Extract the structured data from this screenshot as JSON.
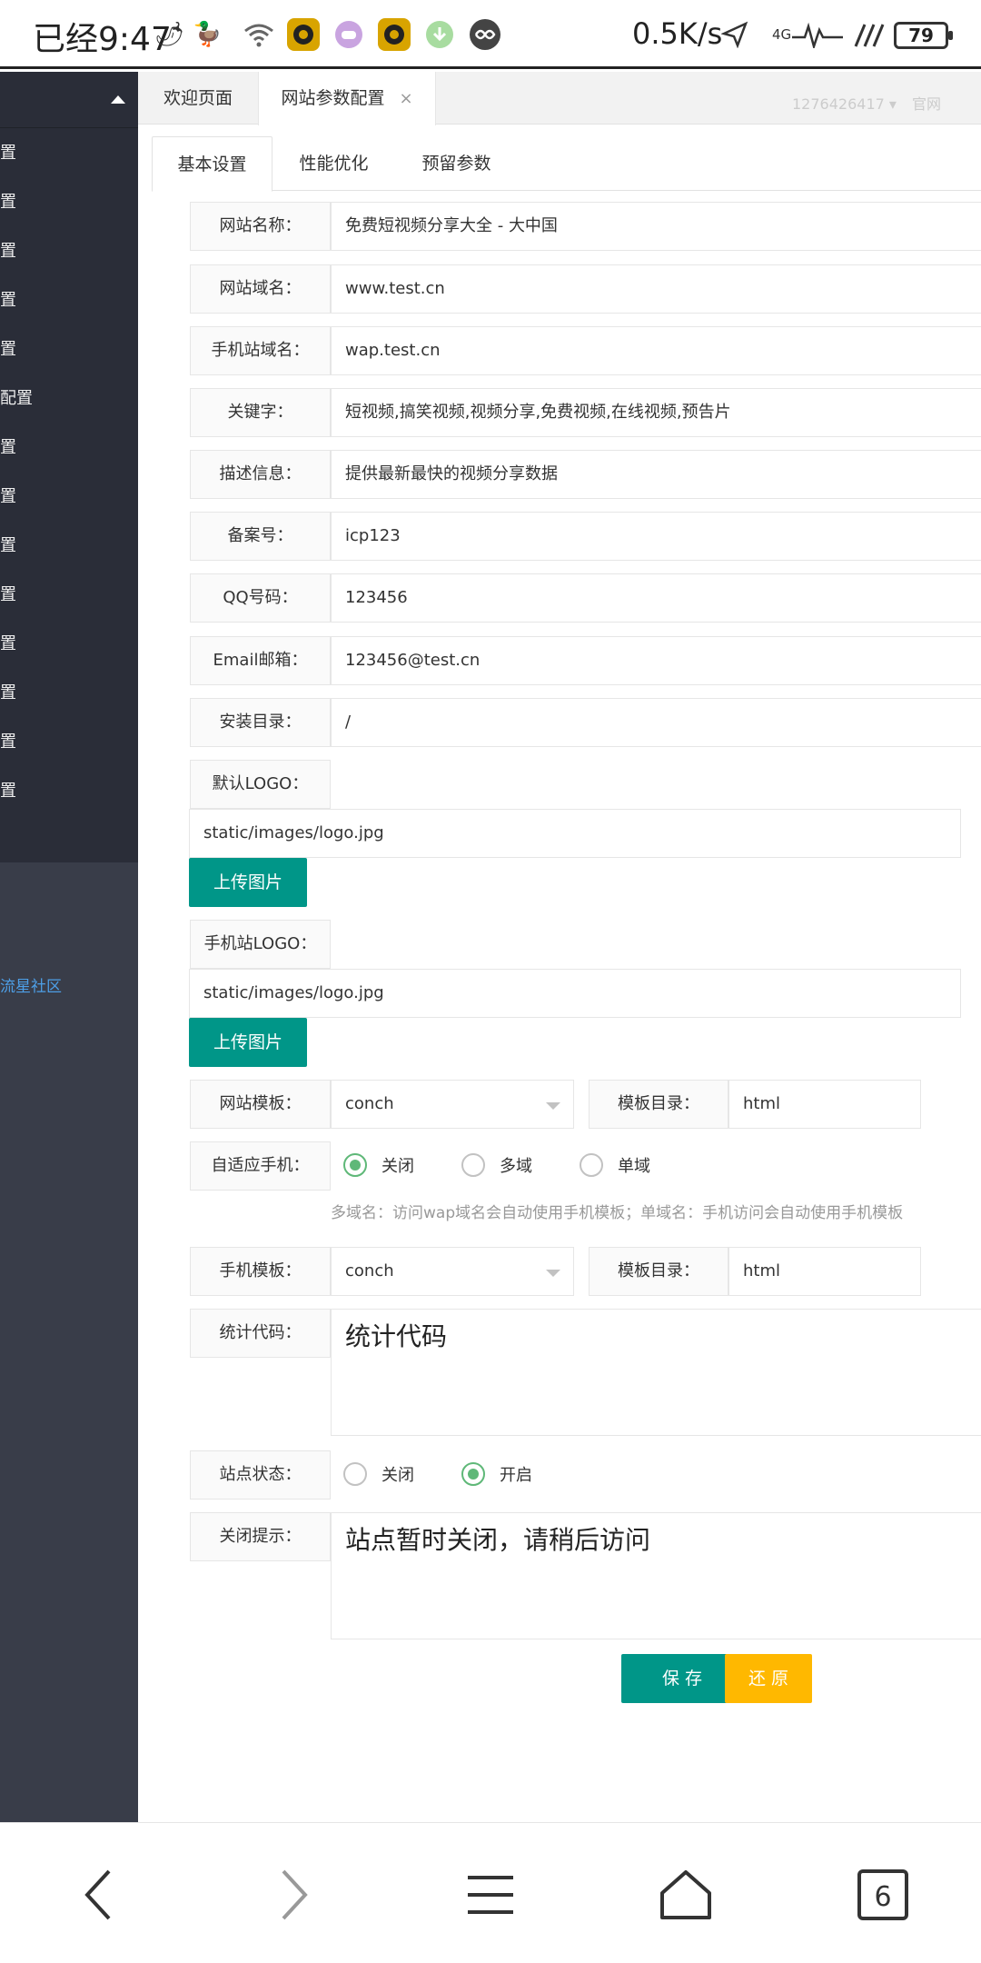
{
  "status_bar": {
    "time": "已经9:47",
    "speed": "0.5K/s",
    "network": "4G",
    "battery": "79"
  },
  "sidebar": {
    "items": [
      "置",
      "置",
      "置",
      "置",
      "置",
      "配置",
      "置",
      "置",
      "置",
      "置",
      "置",
      "置",
      "置",
      "置"
    ],
    "community": "流星社区"
  },
  "top_tabs": {
    "welcome": "欢迎页面",
    "config": "网站参数配置",
    "close": "×",
    "user": "1276426417",
    "site": "官网"
  },
  "content_tabs": [
    "基本设置",
    "性能优化",
    "预留参数"
  ],
  "form": {
    "site_name": {
      "label": "网站名称：",
      "value": "免费短视频分享大全 - 大中国"
    },
    "domain": {
      "label": "网站域名：",
      "value": "www.test.cn"
    },
    "mobile_domain": {
      "label": "手机站域名：",
      "value": "wap.test.cn"
    },
    "keywords": {
      "label": "关键字：",
      "value": "短视频,搞笑视频,视频分享,免费视频,在线视频,预告片"
    },
    "description": {
      "label": "描述信息：",
      "value": "提供最新最快的视频分享数据"
    },
    "icp": {
      "label": "备案号：",
      "value": "icp123"
    },
    "qq": {
      "label": "QQ号码：",
      "value": "123456"
    },
    "email": {
      "label": "Email邮箱：",
      "value": "123456@test.cn"
    },
    "install_dir": {
      "label": "安装目录：",
      "value": "/"
    },
    "logo": {
      "label": "默认LOGO：",
      "value": "static/images/logo.jpg",
      "button": "上传图片"
    },
    "mobile_logo": {
      "label": "手机站LOGO：",
      "value": "static/images/logo.jpg",
      "button": "上传图片"
    },
    "template": {
      "label": "网站模板：",
      "value": "conch",
      "dir_label": "模板目录：",
      "dir_value": "html"
    },
    "adaptive": {
      "label": "自适应手机：",
      "options": [
        "关闭",
        "多域",
        "单域"
      ],
      "selected": "关闭",
      "hint": "多域名：访问wap域名会自动使用手机模板；单域名：手机访问会自动使用手机模板"
    },
    "mobile_template": {
      "label": "手机模板：",
      "value": "conch",
      "dir_label": "模板目录：",
      "dir_value": "html"
    },
    "stats_code": {
      "label": "统计代码：",
      "value": "统计代码"
    },
    "site_status": {
      "label": "站点状态：",
      "options": [
        "关闭",
        "开启"
      ],
      "selected": "开启"
    },
    "close_tip": {
      "label": "关闭提示：",
      "value": "站点暂时关闭，请稍后访问"
    },
    "save": "保 存",
    "reset": "还 原"
  },
  "bottom_nav": {
    "tabs_count": "6"
  },
  "colors": {
    "primary": "#009688",
    "warn": "#ffb800",
    "sidebar": "#393d49",
    "radio_on": "#5fb878"
  }
}
